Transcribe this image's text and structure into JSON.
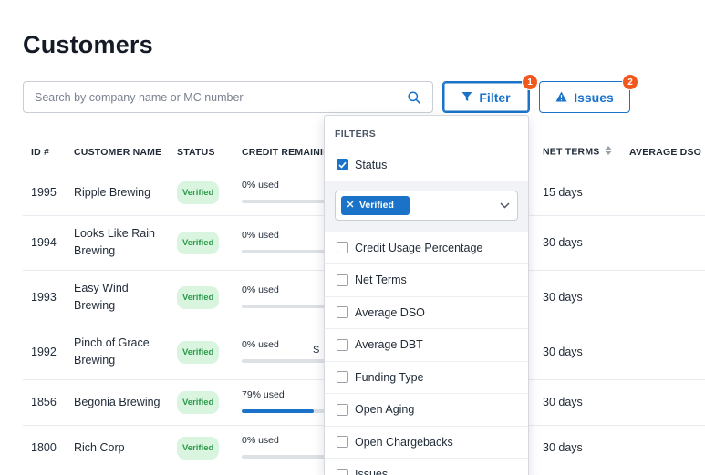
{
  "page": {
    "title": "Customers"
  },
  "search": {
    "placeholder": "Search by company name or MC number"
  },
  "toolbar": {
    "filter_label": "Filter",
    "filter_badge": "1",
    "issues_label": "Issues",
    "issues_badge": "2"
  },
  "colors": {
    "accent": "#1a73c9",
    "badge": "#f2581c",
    "verified_bg": "#d9f5df",
    "verified_text": "#2c9a4a"
  },
  "table": {
    "headers": {
      "id": "ID #",
      "name": "CUSTOMER NAME",
      "status": "STATUS",
      "credit": "CREDIT REMAINING",
      "net_terms": "NET TERMS",
      "avg_dso": "AVERAGE DSO"
    },
    "rows": [
      {
        "id": "1995",
        "name": "Ripple Brewing",
        "status": "Verified",
        "credit_text": "0% used",
        "credit_pct": 0,
        "net_terms": "15 days"
      },
      {
        "id": "1994",
        "name": "Looks Like Rain Brewing",
        "status": "Verified",
        "credit_text": "0% used",
        "credit_pct": 0,
        "net_terms": "30 days"
      },
      {
        "id": "1993",
        "name": "Easy Wind Brewing",
        "status": "Verified",
        "credit_text": "0% used",
        "credit_pct": 0,
        "net_terms": "30 days"
      },
      {
        "id": "1992",
        "name": "Pinch of Grace Brewing",
        "status": "Verified",
        "credit_text": "0% used",
        "credit_pct": 0,
        "net_terms": "30 days",
        "extra": "S"
      },
      {
        "id": "1856",
        "name": "Begonia Brewing",
        "status": "Verified",
        "credit_text": "79% used",
        "credit_pct": 79,
        "net_terms": "30 days"
      },
      {
        "id": "1800",
        "name": "Rich Corp",
        "status": "Verified",
        "credit_text": "0% used",
        "credit_pct": 0,
        "net_terms": "30 days"
      }
    ]
  },
  "filters": {
    "header": "FILTERS",
    "status_label": "Status",
    "status_checked": true,
    "status_selected": "Verified",
    "options": [
      {
        "label": "Credit Usage Percentage",
        "checked": false
      },
      {
        "label": "Net Terms",
        "checked": false
      },
      {
        "label": "Average DSO",
        "checked": false
      },
      {
        "label": "Average DBT",
        "checked": false
      },
      {
        "label": "Funding Type",
        "checked": false
      },
      {
        "label": "Open Aging",
        "checked": false
      },
      {
        "label": "Open Chargebacks",
        "checked": false
      },
      {
        "label": "Issues",
        "checked": false
      }
    ]
  }
}
